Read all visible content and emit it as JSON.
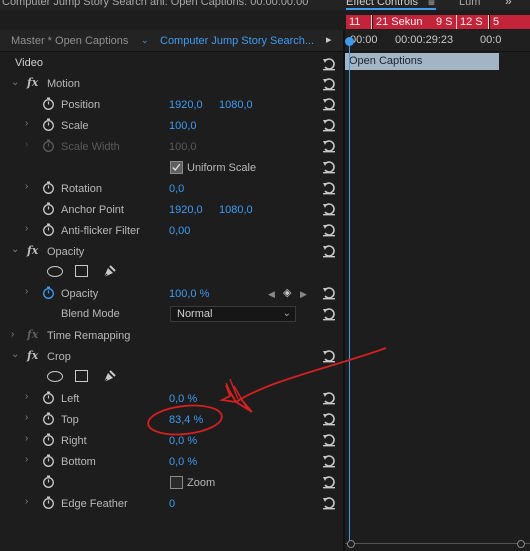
{
  "window": {
    "title_fragment": "Computer Jump Story Search ahi: Open Captions: 00:00:00:00",
    "tabs": {
      "effect_controls": "Effect Controls",
      "effect_controls_menu": "≡",
      "lumetri": "Lum",
      "overflow": "»"
    }
  },
  "header": {
    "master_label": "Master * Open Captions",
    "sequence_label": "Computer Jump Story Search...",
    "play_icon": "play-icon"
  },
  "timeline": {
    "markers": [
      "11",
      "21 Sekun",
      "9 S",
      "12 S",
      "5"
    ],
    "times": [
      "00:00",
      "00:00:29:23",
      "00:0"
    ],
    "clip_label": "Open Captions",
    "playhead_color": "#3e9bf0",
    "marker_color": "#c3243a"
  },
  "section_video": "Video",
  "motion": {
    "name": "Motion",
    "position": {
      "label": "Position",
      "x": "1920,0",
      "y": "1080,0"
    },
    "scale": {
      "label": "Scale",
      "value": "100,0"
    },
    "scale_width": {
      "label": "Scale Width",
      "value": "100,0"
    },
    "uniform_scale": {
      "label": "Uniform Scale",
      "checked": true
    },
    "rotation": {
      "label": "Rotation",
      "value": "0,0"
    },
    "anchor_point": {
      "label": "Anchor Point",
      "x": "1920,0",
      "y": "1080,0"
    },
    "anti_flicker": {
      "label": "Anti-flicker Filter",
      "value": "0,00"
    }
  },
  "opacity": {
    "name": "Opacity",
    "opacity": {
      "label": "Opacity",
      "value": "100,0 %"
    },
    "blend_mode": {
      "label": "Blend Mode",
      "value": "Normal"
    }
  },
  "time_remapping": {
    "name": "Time Remapping"
  },
  "crop": {
    "name": "Crop",
    "left": {
      "label": "Left",
      "value": "0,0 %"
    },
    "top": {
      "label": "Top",
      "value": "83,4 %"
    },
    "right": {
      "label": "Right",
      "value": "0,0 %"
    },
    "bottom": {
      "label": "Bottom",
      "value": "0,0 %"
    },
    "zoom": {
      "label": "Zoom",
      "checked": false
    },
    "edge_feather": {
      "label": "Edge Feather",
      "value": "0"
    }
  },
  "annotation_color": "#d42020"
}
